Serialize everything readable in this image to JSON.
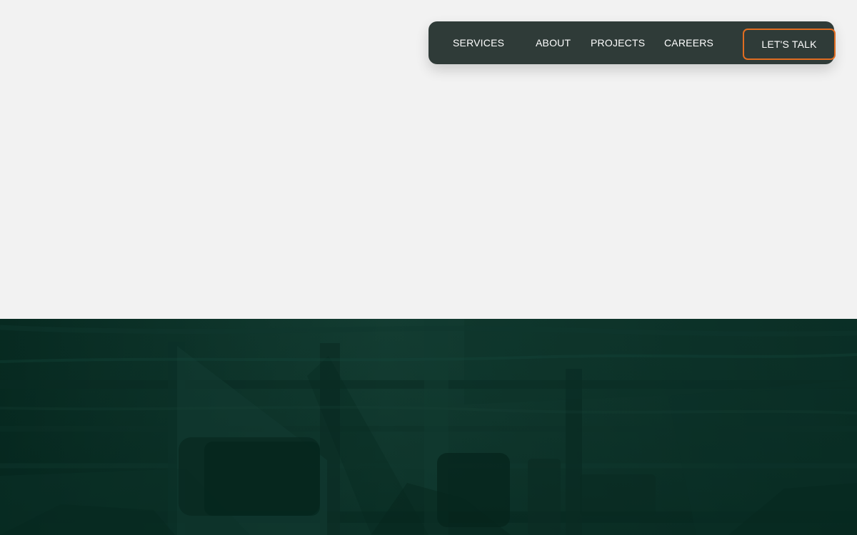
{
  "navigation": {
    "items": [
      {
        "label": "SERVICES"
      },
      {
        "label": "ABOUT"
      },
      {
        "label": "PROJECTS"
      },
      {
        "label": "CAREERS"
      }
    ],
    "cta": {
      "label": "LET'S TALK"
    }
  },
  "colors": {
    "page_background": "#f2f2f2",
    "nav_background": "#2f3b38",
    "accent": "#e16d21",
    "hero_dark_green": "#12382f"
  }
}
